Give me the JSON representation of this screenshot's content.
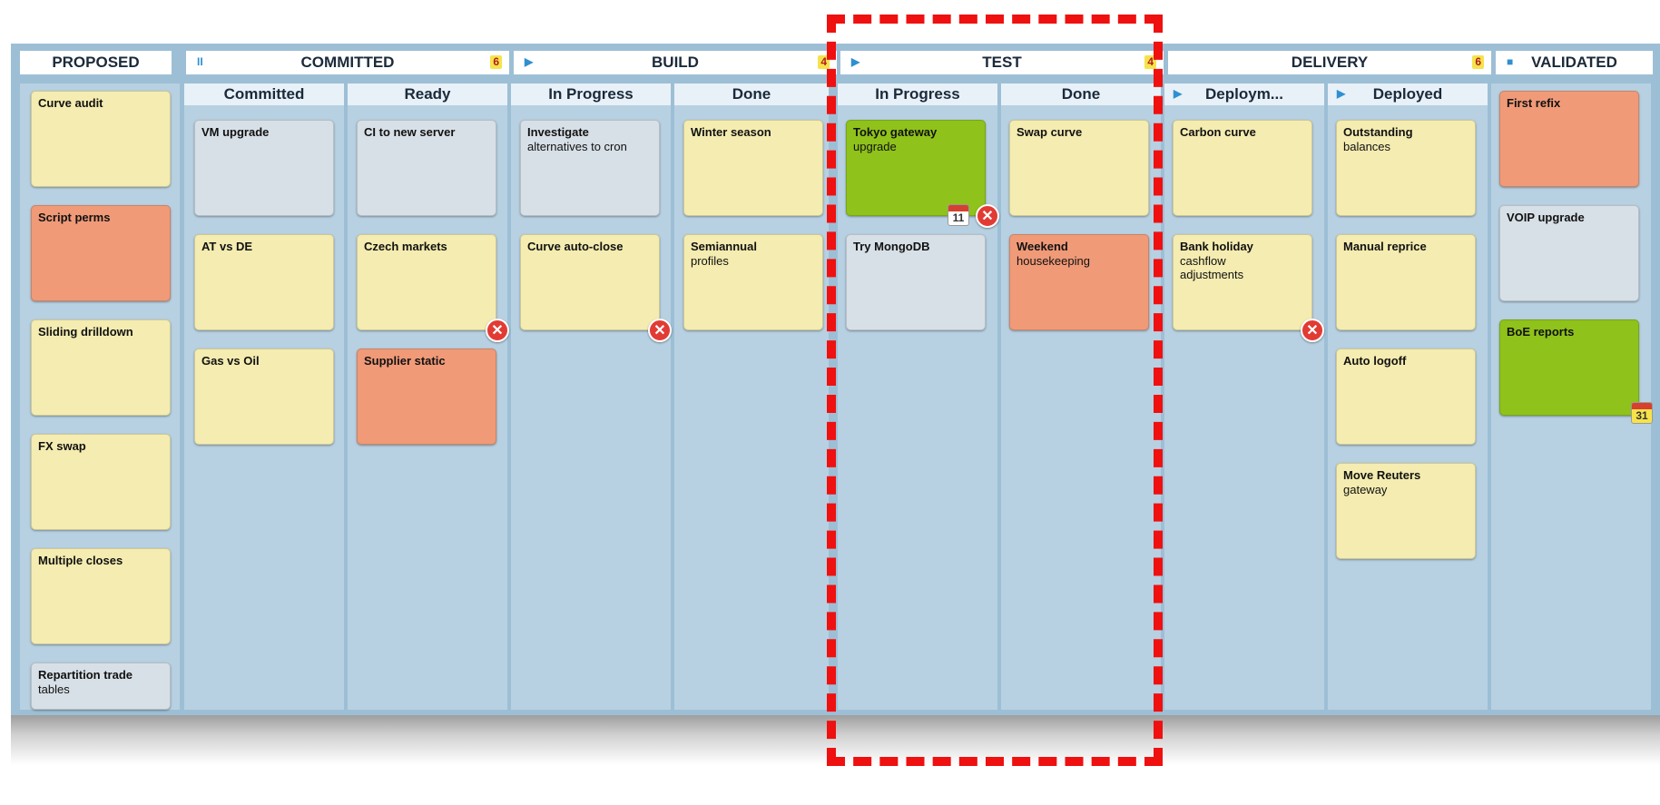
{
  "groups": [
    {
      "title": "PROPOSED",
      "count": "",
      "symbol": ""
    },
    {
      "title": "COMMITTED",
      "count": "6",
      "symbol": "II"
    },
    {
      "title": "BUILD",
      "count": "4",
      "symbol": "▶"
    },
    {
      "title": "TEST",
      "count": "4",
      "symbol": "▶"
    },
    {
      "title": "DELIVERY",
      "count": "6",
      "symbol": ""
    },
    {
      "title": "VALIDATED",
      "count": "",
      "symbol": "■"
    }
  ],
  "lanes": [
    {
      "label": "Committed",
      "symbol": ""
    },
    {
      "label": "Ready",
      "symbol": ""
    },
    {
      "label": "In Progress",
      "symbol": ""
    },
    {
      "label": "Done",
      "symbol": ""
    },
    {
      "label": "In Progress",
      "symbol": ""
    },
    {
      "label": "Done",
      "symbol": ""
    },
    {
      "label": "Deploym...",
      "symbol": "▶"
    },
    {
      "label": "Deployed",
      "symbol": "▶"
    }
  ],
  "cards": {
    "proposed": [
      {
        "title": "Curve audit",
        "sub": "",
        "color": "yellow"
      },
      {
        "title": "Script perms",
        "sub": "",
        "color": "salmon"
      },
      {
        "title": "Sliding drilldown",
        "sub": "",
        "color": "yellow"
      },
      {
        "title": "FX swap",
        "sub": "",
        "color": "yellow"
      },
      {
        "title": "Multiple closes",
        "sub": "",
        "color": "yellow"
      },
      {
        "title": "Repartition trade",
        "sub": "tables",
        "color": "grey"
      }
    ],
    "committed": [
      {
        "title": "VM upgrade",
        "sub": "",
        "color": "grey"
      },
      {
        "title": "AT vs DE",
        "sub": "",
        "color": "yellow"
      },
      {
        "title": "Gas vs Oil",
        "sub": "",
        "color": "yellow"
      }
    ],
    "ready": [
      {
        "title": "CI to new server",
        "sub": "",
        "color": "grey"
      },
      {
        "title": "Czech markets",
        "sub": "",
        "color": "yellow"
      },
      {
        "title": "Supplier static",
        "sub": "",
        "color": "salmon"
      }
    ],
    "build_progress": [
      {
        "title": "Investigate",
        "sub": "alternatives to cron",
        "color": "grey"
      },
      {
        "title": "Curve auto-close",
        "sub": "",
        "color": "yellow"
      }
    ],
    "build_done": [
      {
        "title": "Winter season",
        "sub": "",
        "color": "yellow"
      },
      {
        "title": "Semiannual",
        "sub": "profiles",
        "color": "yellow"
      }
    ],
    "test_progress": [
      {
        "title": "Tokyo gateway",
        "sub": "upgrade",
        "color": "green"
      },
      {
        "title": "Try MongoDB",
        "sub": "",
        "color": "grey"
      }
    ],
    "test_done": [
      {
        "title": "Swap curve",
        "sub": "",
        "color": "yellow"
      },
      {
        "title": "Weekend",
        "sub": "housekeeping",
        "color": "salmon"
      }
    ],
    "deploying": [
      {
        "title": "Carbon curve",
        "sub": "",
        "color": "yellow"
      },
      {
        "title": "Bank holiday",
        "sub": "cashflow\nadjustments",
        "color": "yellow"
      }
    ],
    "deployed": [
      {
        "title": "Outstanding",
        "sub": "balances",
        "color": "yellow"
      },
      {
        "title": "Manual reprice",
        "sub": "",
        "color": "yellow"
      },
      {
        "title": "Auto logoff",
        "sub": "",
        "color": "yellow"
      },
      {
        "title": "Move Reuters",
        "sub": "gateway",
        "color": "yellow"
      }
    ],
    "validated": [
      {
        "title": "First refix",
        "sub": "",
        "color": "salmon"
      },
      {
        "title": "VOIP upgrade",
        "sub": "",
        "color": "grey"
      },
      {
        "title": "BoE reports",
        "sub": "",
        "color": "green"
      }
    ]
  },
  "calendar_badges": {
    "tokyo": "11",
    "boe": "31"
  },
  "close_glyph": "✕"
}
